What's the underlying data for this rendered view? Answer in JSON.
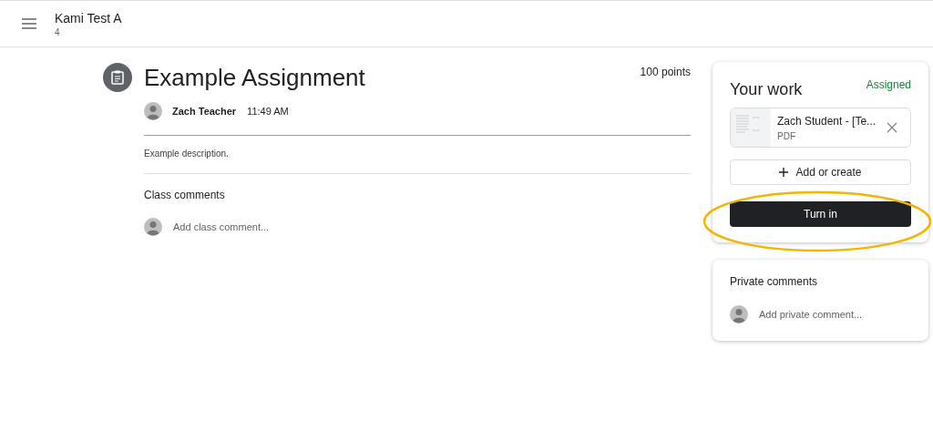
{
  "header": {
    "class_name": "Kami Test A",
    "section": "4"
  },
  "assignment": {
    "title": "Example Assignment",
    "points": "100 points",
    "author": "Zach Teacher",
    "time": "11:49 AM",
    "description": "Example description."
  },
  "class_comments": {
    "heading": "Class comments",
    "placeholder": "Add class comment..."
  },
  "your_work": {
    "title": "Your work",
    "status": "Assigned",
    "attachment": {
      "name": "Zach Student - [Te...",
      "type": "PDF"
    },
    "add_button": "Add or create",
    "turn_in_button": "Turn in",
    "highlighted": true
  },
  "private_comments": {
    "heading": "Private comments",
    "placeholder": "Add private comment..."
  }
}
